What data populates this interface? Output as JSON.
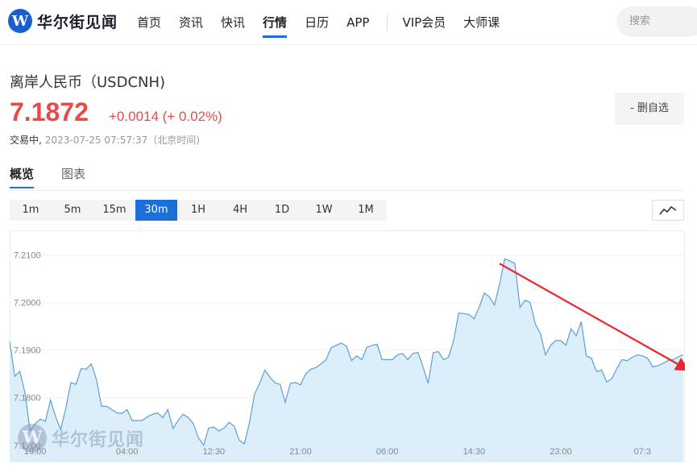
{
  "header": {
    "logo_text": "华尔街见闻",
    "nav": [
      "首页",
      "资讯",
      "快讯",
      "行情",
      "日历",
      "APP",
      "VIP会员",
      "大师课"
    ],
    "active_nav": 3,
    "search_placeholder": "搜索"
  },
  "quote": {
    "name": "离岸人民币（USDCNH)",
    "price": "7.1872",
    "change": "+0.0014 (+ 0.02%)",
    "status": "交易中,",
    "timestamp": "2023-07-25 07:57:37（北京时间)",
    "watch_button": "- 删自选"
  },
  "tabs": [
    "概览",
    "图表"
  ],
  "periods": [
    "1m",
    "5m",
    "15m",
    "30m",
    "1H",
    "4H",
    "1D",
    "1W",
    "1M"
  ],
  "active_period": "30m",
  "watermark": "华尔街见闻",
  "colors": {
    "accent": "#1a6fd8",
    "up": "#e84a4a",
    "line": "#5a9fd8",
    "area": "#ddeefb",
    "arrow": "#e8262c"
  },
  "chart_data": {
    "type": "area",
    "y_ticks": [
      "7.1700",
      "7.1800",
      "7.1900",
      "7.2000",
      "7.2100"
    ],
    "ylim": [
      7.1664,
      7.2152
    ],
    "x_ticks": [
      {
        "label": "19:00",
        "index": 5
      },
      {
        "label": "04:00",
        "index": 23
      },
      {
        "label": "12:30",
        "index": 40
      },
      {
        "label": "21:00",
        "index": 57
      },
      {
        "label": "06:00",
        "index": 74
      },
      {
        "label": "14:30",
        "index": 91
      },
      {
        "label": "23:00",
        "index": 108
      },
      {
        "label": "07:3",
        "index": 124
      }
    ],
    "values": [
      7.1918,
      7.1845,
      7.1855,
      7.181,
      7.173,
      7.1745,
      7.1755,
      7.175,
      7.1795,
      7.176,
      7.1733,
      7.1778,
      7.1832,
      7.1828,
      7.1861,
      7.186,
      7.1871,
      7.1838,
      7.1782,
      7.1782,
      7.1775,
      7.1768,
      7.1767,
      7.1775,
      7.1752,
      7.1752,
      7.1752,
      7.176,
      7.1765,
      7.1768,
      7.1758,
      7.1775,
      7.1735,
      7.1752,
      7.1765,
      7.1758,
      7.1745,
      7.1715,
      7.17,
      7.1736,
      7.1738,
      7.173,
      7.1736,
      7.1748,
      7.174,
      7.171,
      7.1703,
      7.1748,
      7.1808,
      7.183,
      7.1858,
      7.1843,
      7.1831,
      7.1828,
      7.179,
      7.183,
      7.1832,
      7.1827,
      7.185,
      7.186,
      7.1863,
      7.1871,
      7.188,
      7.1905,
      7.191,
      7.1915,
      7.1908,
      7.1878,
      7.1888,
      7.188,
      7.1906,
      7.191,
      7.1912,
      7.188,
      7.188,
      7.188,
      7.189,
      7.1893,
      7.188,
      7.1893,
      7.1895,
      7.1865,
      7.183,
      7.1895,
      7.1897,
      7.188,
      7.1885,
      7.192,
      7.1978,
      7.1977,
      7.1975,
      7.1966,
      7.199,
      7.202,
      7.2012,
      7.1995,
      7.2039,
      7.2092,
      7.2088,
      7.2082,
      7.199,
      7.2005,
      7.2,
      7.1955,
      7.1935,
      7.189,
      7.191,
      7.192,
      7.192,
      7.191,
      7.1945,
      7.193,
      7.196,
      7.1888,
      7.1883,
      7.1855,
      7.1858,
      7.1833,
      7.184,
      7.1862,
      7.188,
      7.1878,
      7.1885,
      7.189,
      7.1888,
      7.1883,
      7.1865,
      7.1867,
      7.1872,
      7.1878,
      7.188,
      7.1886,
      7.189
    ],
    "annotation_arrow": {
      "from": [
        96,
        7.2082
      ],
      "to": [
        133,
        7.1872
      ]
    }
  }
}
